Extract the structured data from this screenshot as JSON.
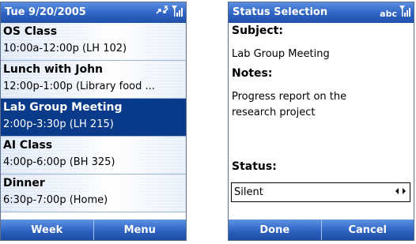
{
  "calendar": {
    "title": "Tue 9/20/2005",
    "icons": [
      "sync-disconnected-icon",
      "signal-strength-icon"
    ],
    "items": [
      {
        "subject": "OS Class",
        "when": "10:00a-12:00p (LH 102)"
      },
      {
        "subject": "Lunch with John",
        "when": "12:00p-1:00p (Library food ..."
      },
      {
        "subject": "Lab Group Meeting",
        "when": "2:00p-3:30p (LH 215)",
        "selected": true
      },
      {
        "subject": "AI Class",
        "when": "4:00p-6:00p (BH 325)"
      },
      {
        "subject": "Dinner",
        "when": "6:30p-7:00p (Home)"
      }
    ],
    "softkeys": {
      "left": "Week",
      "right": "Menu"
    }
  },
  "status_selection": {
    "title": "Status Selection",
    "input_mode": "abc",
    "icons": [
      "signal-strength-icon"
    ],
    "subject_label": "Subject:",
    "subject_value": "Lab Group Meeting",
    "notes_label": "Notes:",
    "notes_line1": "Progress report on the",
    "notes_line2": "research project",
    "status_label": "Status:",
    "status_value": "Silent",
    "softkeys": {
      "left": "Done",
      "right": "Cancel"
    }
  },
  "colors": {
    "titlebar": "#2f63c4",
    "selected_row": "#0a3a8a",
    "softkey_bar": "#2e62c2"
  }
}
